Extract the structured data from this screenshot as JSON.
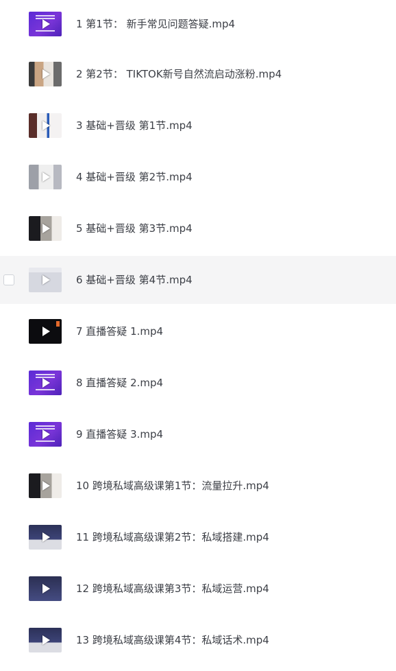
{
  "files": [
    {
      "name": "1 第1节： 新手常见问题答疑.mp4",
      "thumb": "purple"
    },
    {
      "name": "2 第2节： TIKTOK新号自然流启动涨粉.mp4",
      "thumb": "photo1"
    },
    {
      "name": "3 基础+晋级 第1节.mp4",
      "thumb": "photo2"
    },
    {
      "name": "4 基础+晋级 第2节.mp4",
      "thumb": "screen2"
    },
    {
      "name": "5 基础+晋级 第3节.mp4",
      "thumb": "mixed"
    },
    {
      "name": "6 基础+晋级 第4节.mp4",
      "thumb": "screen"
    },
    {
      "name": "7 直播答疑 1.mp4",
      "thumb": "blk"
    },
    {
      "name": "8 直播答疑 2.mp4",
      "thumb": "purple"
    },
    {
      "name": "9 直播答疑 3.mp4",
      "thumb": "purple"
    },
    {
      "name": "10 跨境私域高级课第1节：流量拉升.mp4",
      "thumb": "mixed"
    },
    {
      "name": "11 跨境私域高级课第2节：私域搭建.mp4",
      "thumb": "navy"
    },
    {
      "name": "12 跨境私域高级课第3节：私域运营.mp4",
      "thumb": "navy2"
    },
    {
      "name": "13 跨境私域高级课第4节：私域话术.mp4",
      "thumb": "navy"
    }
  ],
  "hovered_index": 5,
  "colors": {
    "hover_bg": "#f5f5f6",
    "text": "#3c3f46"
  },
  "icons": {
    "play": "play-icon",
    "checkbox": "checkbox-icon"
  }
}
